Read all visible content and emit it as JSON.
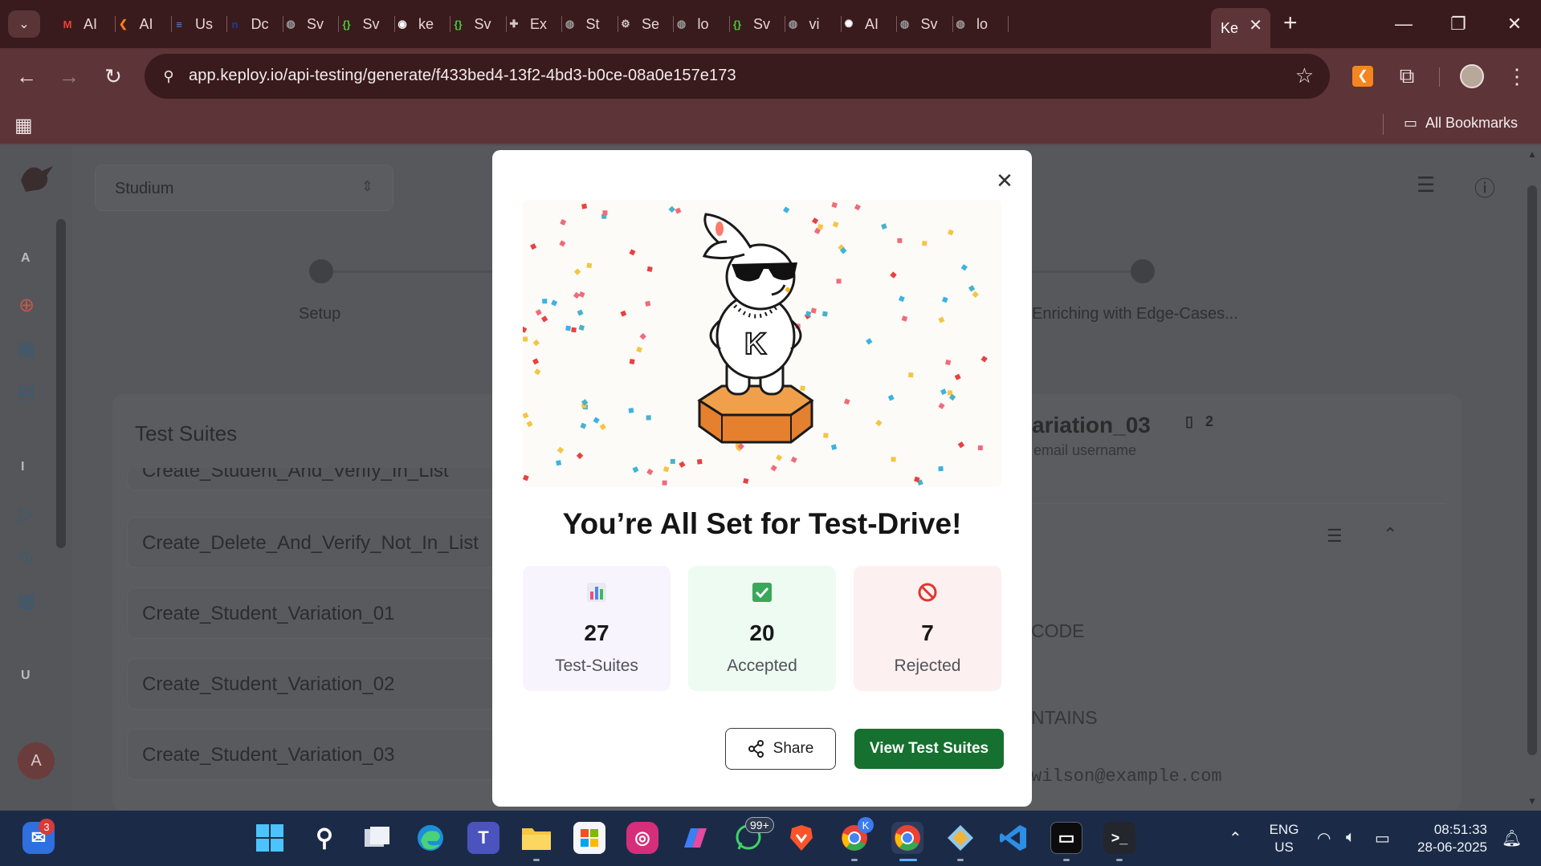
{
  "browser": {
    "tabs": [
      {
        "label": "AI",
        "icon": "gmail-icon",
        "color": "#ea4335",
        "glyph": "M"
      },
      {
        "label": "AI",
        "icon": "keploy-tab-icon",
        "color": "#f97d1c",
        "glyph": "❮"
      },
      {
        "label": "Us",
        "icon": "docs-icon",
        "color": "#4a86f5",
        "glyph": "≡"
      },
      {
        "label": "Dc",
        "icon": "notion-n-icon",
        "color": "#1c3aa9",
        "glyph": "n"
      },
      {
        "label": "Sv",
        "icon": "globe-icon",
        "color": "#9b9b9b",
        "glyph": "◍"
      },
      {
        "label": "Sv",
        "icon": "swagger-icon",
        "color": "#49cc3a",
        "glyph": "{}"
      },
      {
        "label": "ke",
        "icon": "github-icon",
        "color": "#ffffff",
        "glyph": "◉"
      },
      {
        "label": "Sv",
        "icon": "swagger-icon",
        "color": "#49cc3a",
        "glyph": "{}"
      },
      {
        "label": "Ex",
        "icon": "puzzle-icon",
        "color": "#d6c6c6",
        "glyph": "✚"
      },
      {
        "label": "St",
        "icon": "globe-icon",
        "color": "#9b9b9b",
        "glyph": "◍"
      },
      {
        "label": "Se",
        "icon": "gear-icon",
        "color": "#d6c6c6",
        "glyph": "⚙"
      },
      {
        "label": "lo",
        "icon": "globe-icon",
        "color": "#9b9b9b",
        "glyph": "◍"
      },
      {
        "label": "Sv",
        "icon": "swagger-icon",
        "color": "#49cc3a",
        "glyph": "{}"
      },
      {
        "label": "vi",
        "icon": "globe-icon",
        "color": "#9b9b9b",
        "glyph": "◍"
      },
      {
        "label": "AI",
        "icon": "openai-icon",
        "color": "#ffffff",
        "glyph": "✺"
      },
      {
        "label": "Sv",
        "icon": "globe-icon",
        "color": "#9b9b9b",
        "glyph": "◍"
      },
      {
        "label": "lo",
        "icon": "globe-icon",
        "color": "#9b9b9b",
        "glyph": "◍"
      }
    ],
    "active_tab": {
      "label": "Ke"
    },
    "url": "app.keploy.io/api-testing/generate/f433bed4-13f2-4bd3-b0ce-08a0e157e173",
    "all_bookmarks": "All Bookmarks"
  },
  "app": {
    "project": "Studium",
    "sidebar_letters": [
      "A",
      "I",
      "U"
    ],
    "avatar_initial": "A",
    "steps": [
      {
        "label": "Setup"
      },
      {
        "label": "Enriching with Edge-Cases..."
      }
    ],
    "suites_title": "Test Suites",
    "suites": [
      "Create_Student_And_Verify_In_List",
      "Create_Delete_And_Verify_Not_In_List",
      "Create_Student_Variation_01",
      "Create_Student_Variation_02",
      "Create_Student_Variation_03"
    ],
    "detail": {
      "title": "ariation_03",
      "step_count": "2",
      "subtitle": "email username",
      "code_label": "CODE",
      "contains_label": "NTAINS",
      "email": "wilson@example.com"
    }
  },
  "modal": {
    "title": "You’re All Set for Test-Drive!",
    "stats": [
      {
        "value": "27",
        "label": "Test-Suites",
        "icon": "bar-chart-icon",
        "bg": "#f8f4fe"
      },
      {
        "value": "20",
        "label": "Accepted",
        "icon": "check-box-icon",
        "bg": "#eefbf3"
      },
      {
        "value": "7",
        "label": "Rejected",
        "icon": "prohibited-icon",
        "bg": "#fdf0f0"
      }
    ],
    "share_label": "Share",
    "view_label": "View Test Suites",
    "mascot_letter": "K"
  },
  "taskbar": {
    "chat_badge": "3",
    "whatsapp_badge": "99+",
    "chrome_badge": "K",
    "lang_line1": "ENG",
    "lang_line2": "US",
    "time": "08:51:33",
    "date": "28-06-2025"
  }
}
